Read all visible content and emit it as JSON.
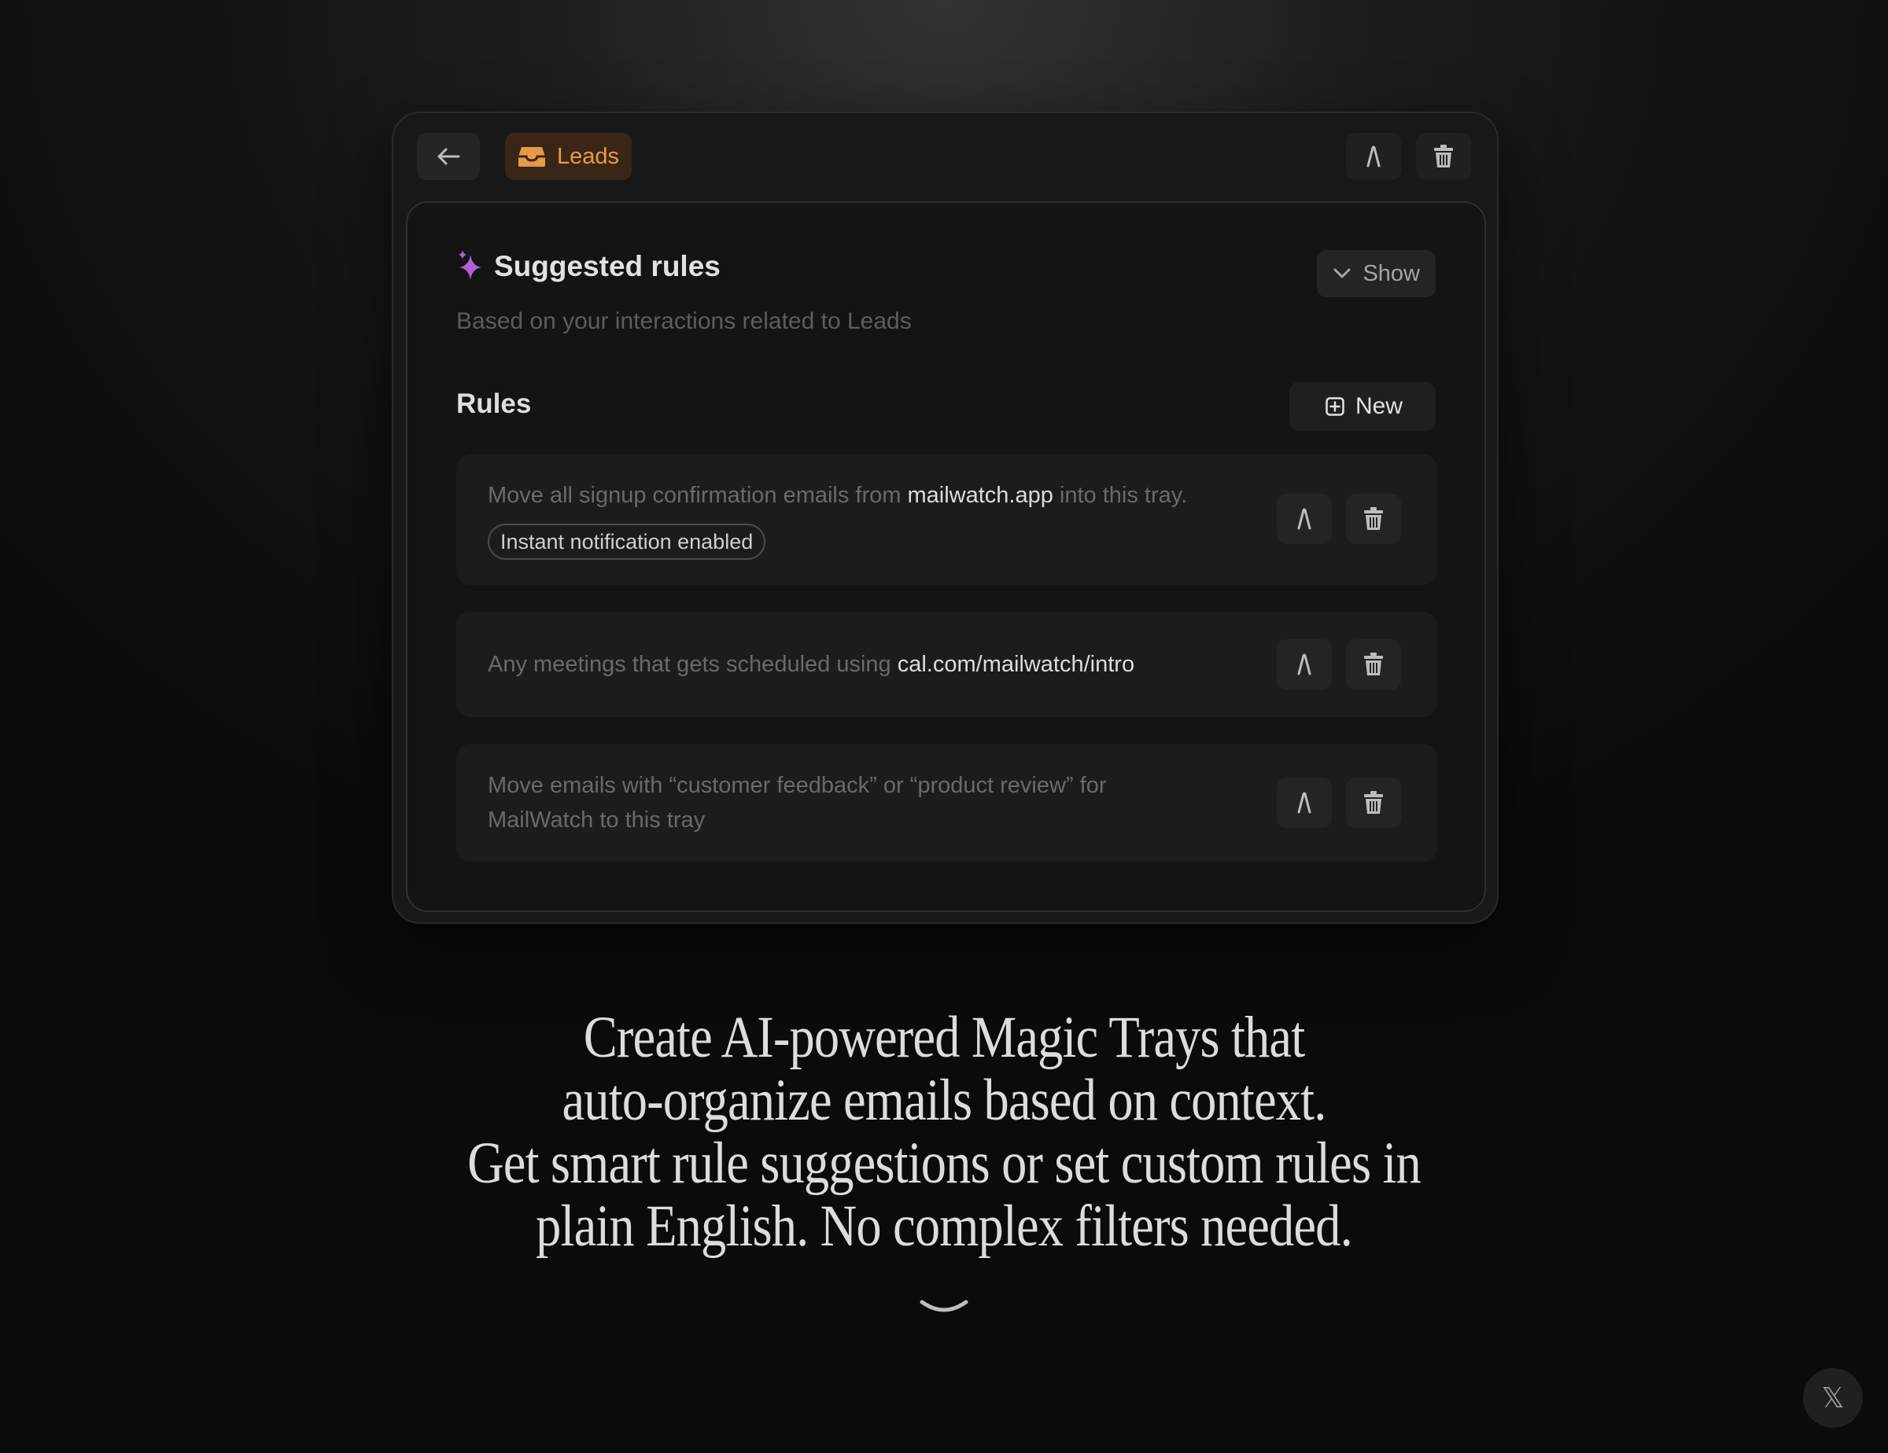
{
  "header": {
    "tray_name": "Leads",
    "icons": {
      "back": "arrow-left-icon",
      "tray": "inbox-tray-icon",
      "edit": "pen-nib-icon",
      "delete": "trash-icon"
    },
    "tray_color": "#e89a48"
  },
  "suggested": {
    "title": "Suggested rules",
    "subtitle": "Based on your interactions related to Leads",
    "show_label": "Show",
    "icon": "sparkle-icon",
    "icon_color": "#b45fd6"
  },
  "rules": {
    "title": "Rules",
    "new_label": "New",
    "items": [
      {
        "pre": "Move all signup confirmation emails from ",
        "highlight": "mailwatch.app",
        "post": " into this tray.",
        "badge": "Instant notification enabled"
      },
      {
        "pre": "Any meetings that gets scheduled using ",
        "highlight": "cal.com/mailwatch/intro",
        "post": ""
      },
      {
        "line1": "Move emails with “customer feedback” or “product review” for",
        "line2": "MailWatch to this tray"
      }
    ]
  },
  "headline": {
    "line1": "Create AI-powered Magic Trays that",
    "line2": "auto-organize emails based on context.",
    "line3": "Get smart rule suggestions or set custom rules in",
    "line4": "plain English. No complex filters needed."
  },
  "footer": {
    "close_label": "𝕏"
  }
}
